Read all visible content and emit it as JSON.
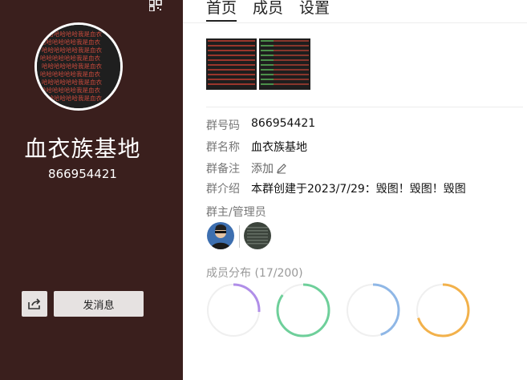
{
  "group": {
    "avatar_text": "哈哈哈哈哈哈我是血衣",
    "name": "血衣族基地",
    "id": "866954421"
  },
  "sidebar": {
    "send_label": "发消息",
    "share_icon": "share-icon",
    "qr_icon": "qr-code-icon"
  },
  "tabs": [
    {
      "label": "首页",
      "active": true
    },
    {
      "label": "成员",
      "active": false
    },
    {
      "label": "设置",
      "active": false
    }
  ],
  "info": [
    {
      "label": "群号码",
      "value": "866954421"
    },
    {
      "label": "群名称",
      "value": "血衣族基地"
    },
    {
      "label": "群备注",
      "value": "添加"
    },
    {
      "label": "群介绍",
      "value": "本群创建于2023/7/29：毁图！毁图！毁图"
    }
  ],
  "admins": {
    "label": "群主/管理员"
  },
  "distribution": {
    "label": "成员分布 (17/200)",
    "rings": [
      {
        "color": "#b08ee8",
        "fraction": 0.26
      },
      {
        "color": "#6ecf9a",
        "fraction": 0.85
      },
      {
        "color": "#8fb7e6",
        "fraction": 0.45
      },
      {
        "color": "#f2b14b",
        "fraction": 0.7
      }
    ]
  },
  "colors": {
    "sidebar_bg": "#3a1f1d"
  }
}
